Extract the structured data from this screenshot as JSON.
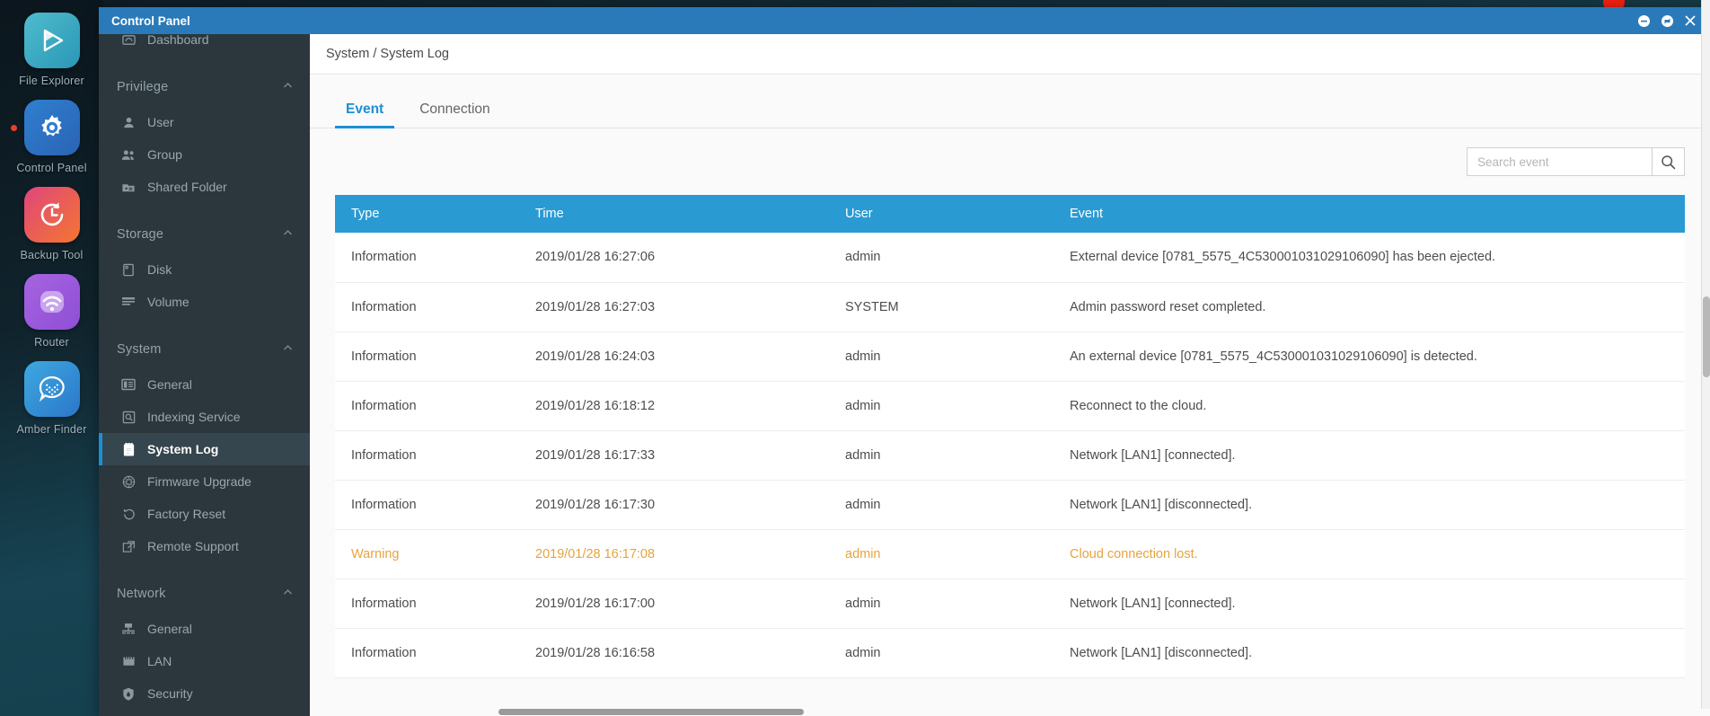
{
  "desktop": {
    "dock": [
      {
        "label": "File Explorer",
        "icon": "play-triangle-icon",
        "running": false
      },
      {
        "label": "Control Panel",
        "icon": "gear-icon",
        "running": true
      },
      {
        "label": "Backup Tool",
        "icon": "clock-rotate-icon",
        "running": false
      },
      {
        "label": "Router",
        "icon": "wifi-icon",
        "running": false
      },
      {
        "label": "Amber Finder",
        "icon": "chat-bubble-icon",
        "running": false
      }
    ]
  },
  "window": {
    "title": "Control Panel",
    "controls": {
      "minimize": "minimize-icon",
      "maximize": "maximize-icon",
      "close": "close-icon"
    }
  },
  "sidebar": {
    "top_partial_item": {
      "label": "Dashboard",
      "icon": "dashboard-icon"
    },
    "groups": [
      {
        "title": "Privilege",
        "items": [
          {
            "label": "User",
            "icon": "user-icon"
          },
          {
            "label": "Group",
            "icon": "group-icon"
          },
          {
            "label": "Shared Folder",
            "icon": "folder-icon"
          }
        ]
      },
      {
        "title": "Storage",
        "items": [
          {
            "label": "Disk",
            "icon": "disk-icon"
          },
          {
            "label": "Volume",
            "icon": "volume-icon"
          }
        ]
      },
      {
        "title": "System",
        "items": [
          {
            "label": "General",
            "icon": "general-icon"
          },
          {
            "label": "Indexing Service",
            "icon": "indexing-icon"
          },
          {
            "label": "System Log",
            "icon": "log-icon",
            "active": true
          },
          {
            "label": "Firmware Upgrade",
            "icon": "firmware-icon"
          },
          {
            "label": "Factory Reset",
            "icon": "reset-icon"
          },
          {
            "label": "Remote Support",
            "icon": "remote-support-icon"
          }
        ]
      },
      {
        "title": "Network",
        "items": [
          {
            "label": "General",
            "icon": "network-general-icon"
          },
          {
            "label": "LAN",
            "icon": "lan-icon"
          },
          {
            "label": "Security",
            "icon": "shield-icon"
          }
        ]
      }
    ]
  },
  "content": {
    "breadcrumb": "System / System Log",
    "tabs": [
      {
        "label": "Event",
        "active": true
      },
      {
        "label": "Connection",
        "active": false
      }
    ],
    "search": {
      "placeholder": "Search event",
      "value": "",
      "icon": "search-icon"
    },
    "table": {
      "columns": [
        "Type",
        "Time",
        "User",
        "Event"
      ],
      "rows": [
        {
          "type": "Information",
          "time": "2019/01/28 16:27:06",
          "user": "admin",
          "event": "External device [0781_5575_4C530001031029106090] has been ejected.",
          "severity": "information"
        },
        {
          "type": "Information",
          "time": "2019/01/28 16:27:03",
          "user": "SYSTEM",
          "event": "Admin password reset completed.",
          "severity": "information"
        },
        {
          "type": "Information",
          "time": "2019/01/28 16:24:03",
          "user": "admin",
          "event": "An external device [0781_5575_4C530001031029106090] is detected.",
          "severity": "information"
        },
        {
          "type": "Information",
          "time": "2019/01/28 16:18:12",
          "user": "admin",
          "event": "Reconnect to the cloud.",
          "severity": "information"
        },
        {
          "type": "Information",
          "time": "2019/01/28 16:17:33",
          "user": "admin",
          "event": "Network [LAN1] [connected].",
          "severity": "information"
        },
        {
          "type": "Information",
          "time": "2019/01/28 16:17:30",
          "user": "admin",
          "event": "Network [LAN1] [disconnected].",
          "severity": "information"
        },
        {
          "type": "Warning",
          "time": "2019/01/28 16:17:08",
          "user": "admin",
          "event": "Cloud connection lost.",
          "severity": "warning"
        },
        {
          "type": "Information",
          "time": "2019/01/28 16:17:00",
          "user": "admin",
          "event": "Network [LAN1] [connected].",
          "severity": "information"
        },
        {
          "type": "Information",
          "time": "2019/01/28 16:16:58",
          "user": "admin",
          "event": "Network [LAN1] [disconnected].",
          "severity": "information"
        }
      ]
    }
  },
  "colors": {
    "titlebar": "#2a7ab9",
    "accent": "#1b8fd6",
    "table_header": "#2a9ad3",
    "warning": "#e8a33d",
    "sidebar_bg": "#2b373d",
    "sidebar_active_bg": "#36464e"
  }
}
